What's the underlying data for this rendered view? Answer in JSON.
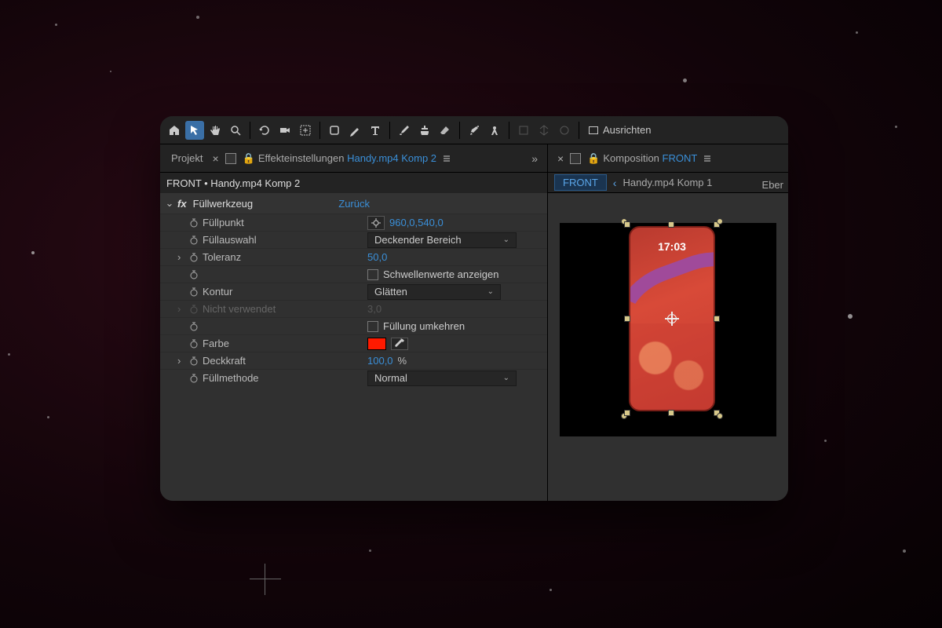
{
  "toolbar": {
    "ausrichten": "Ausrichten"
  },
  "left_tabs": {
    "projekt": "Projekt",
    "effekt": "Effekteinstellungen",
    "effekt_target": "Handy.mp4 Komp 2"
  },
  "breadcrumb": "FRONT • Handy.mp4 Komp 2",
  "fx": {
    "name": "Füllwerkzeug",
    "reset": "Zurück"
  },
  "props": {
    "fuellpunkt": {
      "label": "Füllpunkt",
      "value": "960,0,540,0"
    },
    "fuellauswahl": {
      "label": "Füllauswahl",
      "value": "Deckender Bereich"
    },
    "toleranz": {
      "label": "Toleranz",
      "value": "50,0"
    },
    "schwellen": {
      "label": "Schwellenwerte anzeigen"
    },
    "kontur": {
      "label": "Kontur",
      "value": "Glätten"
    },
    "nichtverwendet": {
      "label": "Nicht verwendet",
      "value": "3,0"
    },
    "umkehren": {
      "label": "Füllung umkehren"
    },
    "farbe": {
      "label": "Farbe",
      "color": "#ff1a00"
    },
    "deckkraft": {
      "label": "Deckkraft",
      "value": "100,0",
      "unit": "%"
    },
    "fuellmethode": {
      "label": "Füllmethode",
      "value": "Normal"
    }
  },
  "right_tabs": {
    "komposition": "Komposition",
    "komp_target": "FRONT",
    "ebenen": "Eber"
  },
  "flow": {
    "current": "FRONT",
    "other": "Handy.mp4 Komp 1"
  },
  "phone": {
    "time": "17:03"
  },
  "colors": {
    "link": "#3a8fd8",
    "swatch": "#ff1a00"
  }
}
